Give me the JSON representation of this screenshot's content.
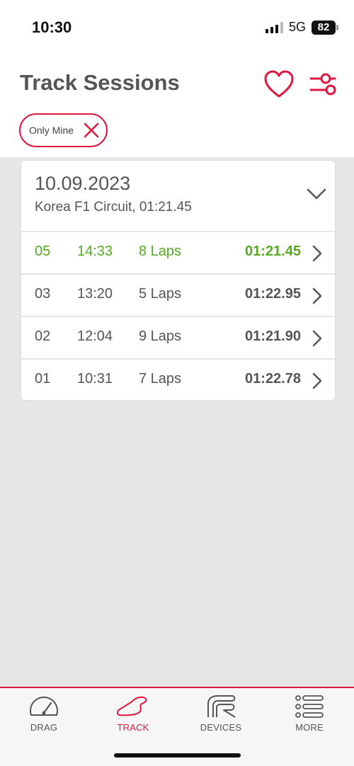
{
  "status": {
    "time": "10:30",
    "network": "5G",
    "battery": "82"
  },
  "header": {
    "title": "Track Sessions",
    "favorite_icon": "heart-icon",
    "filter_icon": "filter-sliders-icon"
  },
  "filter_chip": {
    "label": "Only Mine",
    "remove_icon": "close-icon"
  },
  "session_group": {
    "date": "10.09.2023",
    "subtitle": "Korea F1 Circuit, 01:21.45",
    "sessions": [
      {
        "number": "05",
        "time": "14:33",
        "laps": "8 Laps",
        "best": "01:21.45"
      },
      {
        "number": "03",
        "time": "13:20",
        "laps": "5 Laps",
        "best": "01:22.95"
      },
      {
        "number": "02",
        "time": "12:04",
        "laps": "9 Laps",
        "best": "01:21.90"
      },
      {
        "number": "01",
        "time": "10:31",
        "laps": "7 Laps",
        "best": "01:22.78"
      }
    ]
  },
  "tabs": [
    {
      "label": "DRAG",
      "icon": "speedometer-icon"
    },
    {
      "label": "TRACK",
      "icon": "track-icon",
      "active": true
    },
    {
      "label": "DEVICES",
      "icon": "device-logo-icon"
    },
    {
      "label": "MORE",
      "icon": "menu-list-icon"
    }
  ],
  "colors": {
    "accent": "#e0163d",
    "best": "#56a823",
    "text": "#555555",
    "background": "#e6e6e6"
  }
}
